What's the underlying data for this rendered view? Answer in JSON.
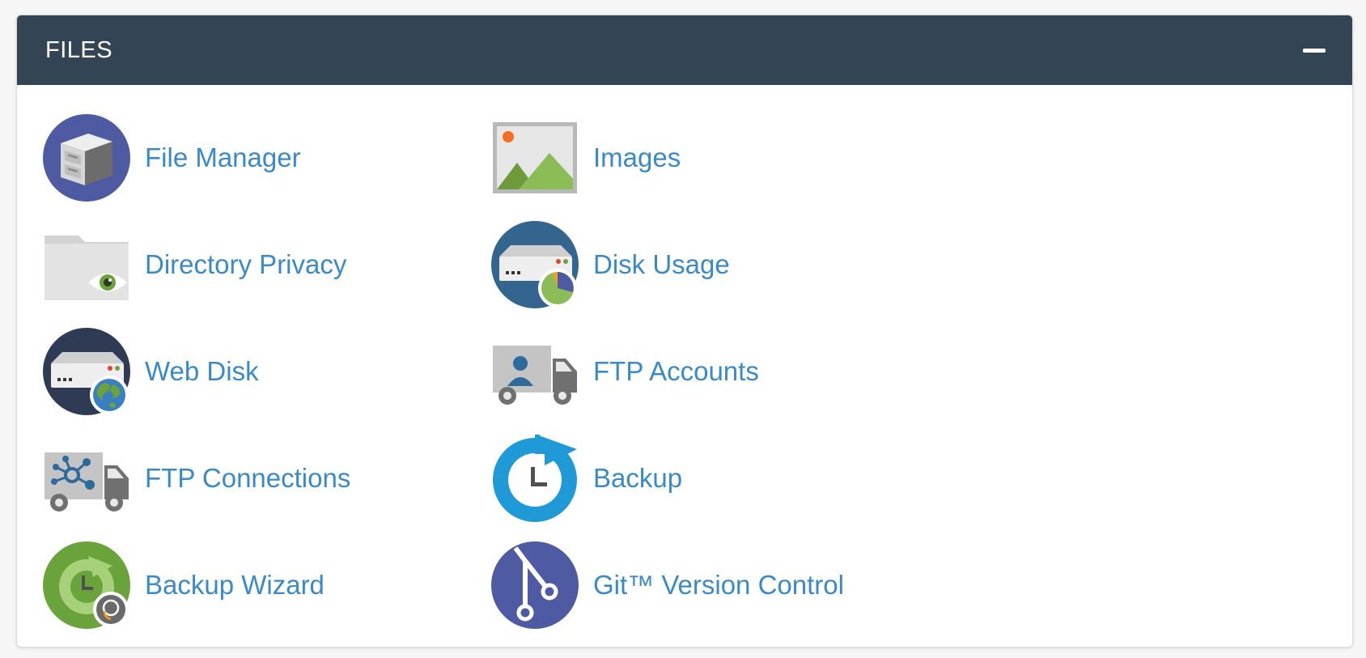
{
  "panel": {
    "title": "FILES",
    "collapse_icon": "minus-icon"
  },
  "colors": {
    "header_bg": "#334454",
    "link": "#3a8ac9",
    "panel_bg": "#ffffff"
  },
  "items": [
    {
      "label": "File Manager",
      "icon": "file-manager-icon"
    },
    {
      "label": "Images",
      "icon": "images-icon"
    },
    {
      "label": "Directory Privacy",
      "icon": "directory-privacy-icon"
    },
    {
      "label": "Disk Usage",
      "icon": "disk-usage-icon"
    },
    {
      "label": "Web Disk",
      "icon": "web-disk-icon"
    },
    {
      "label": "FTP Accounts",
      "icon": "ftp-accounts-icon"
    },
    {
      "label": "FTP Connections",
      "icon": "ftp-connections-icon"
    },
    {
      "label": "Backup",
      "icon": "backup-icon"
    },
    {
      "label": "Backup Wizard",
      "icon": "backup-wizard-icon"
    },
    {
      "label": "Git™ Version Control",
      "icon": "git-version-control-icon"
    }
  ]
}
